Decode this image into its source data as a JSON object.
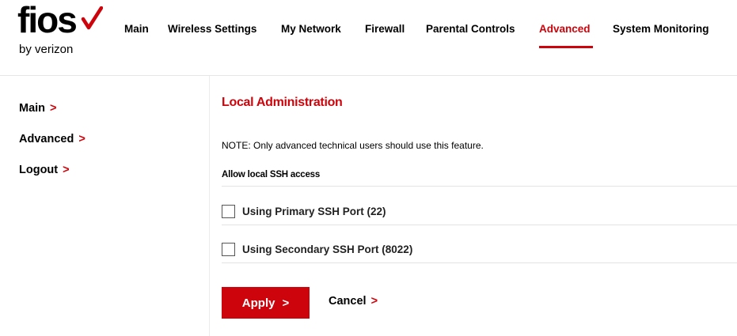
{
  "logo": {
    "word": "fios",
    "sub": "by verizon",
    "check_color": "#cd040b"
  },
  "nav": {
    "items": [
      {
        "label": "Main",
        "active": false
      },
      {
        "label": "Wireless Settings",
        "active": false
      },
      {
        "label": "My Network",
        "active": false
      },
      {
        "label": "Firewall",
        "active": false
      },
      {
        "label": "Parental Controls",
        "active": false
      },
      {
        "label": "Advanced",
        "active": true
      },
      {
        "label": "System Monitoring",
        "active": false
      }
    ]
  },
  "sidebar": {
    "items": [
      {
        "label": "Main",
        "icon": "chevron-right-icon"
      },
      {
        "label": "Advanced",
        "icon": "chevron-right-icon"
      },
      {
        "label": "Logout",
        "icon": "chevron-right-icon"
      }
    ]
  },
  "main": {
    "title": "Local Administration",
    "note": "NOTE: Only advanced technical users should use this feature.",
    "subhead": "Allow local SSH access",
    "options": [
      {
        "label": "Using Primary SSH Port (22)",
        "checked": false
      },
      {
        "label": "Using Secondary SSH Port (8022)",
        "checked": false
      }
    ],
    "apply_label": "Apply",
    "cancel_label": "Cancel",
    "chevron_glyph": ">"
  },
  "colors": {
    "accent": "#cd040b",
    "text": "#000000",
    "divider": "#e3e3e3"
  }
}
